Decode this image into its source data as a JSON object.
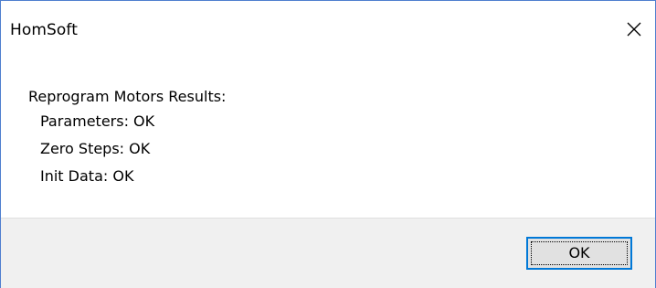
{
  "window": {
    "title": "HomSoft",
    "close_icon": "close-icon"
  },
  "message": {
    "heading": "Reprogram Motors Results:",
    "lines": [
      "Parameters: OK",
      "Zero Steps: OK",
      "Init Data: OK"
    ]
  },
  "buttons": {
    "ok_label": "OK"
  },
  "colors": {
    "border_accent": "#4f7fcf",
    "button_focus": "#0078d7",
    "footer_bg": "#f0f0f0",
    "button_bg": "#e1e1e1"
  }
}
